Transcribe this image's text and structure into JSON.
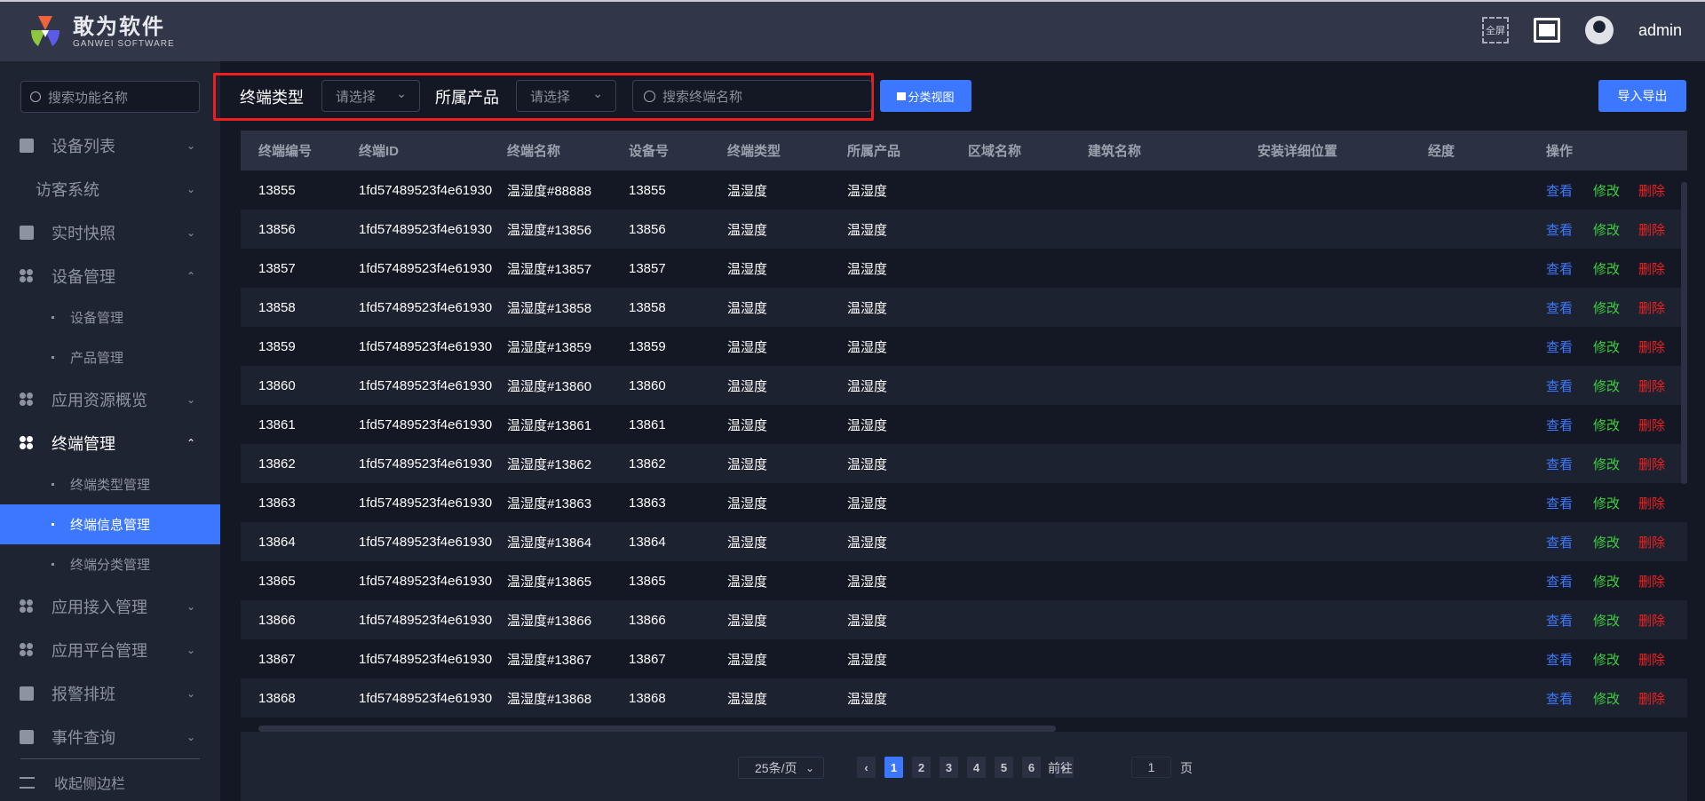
{
  "header": {
    "logo_cn": "敢为软件",
    "logo_en": "GANWEI SOFTWARE",
    "fullscreen_label": "全屏",
    "username": "admin"
  },
  "sidebar": {
    "search_placeholder": "搜索功能名称",
    "items": [
      {
        "label": "设备列表",
        "icon": "monitor-icon",
        "chevron": "⌄"
      },
      {
        "label": "访客系统",
        "icon": "",
        "chevron": "⌄"
      },
      {
        "label": "实时快照",
        "icon": "camera-icon",
        "chevron": "⌄"
      },
      {
        "label": "设备管理",
        "icon": "clover-icon",
        "chevron": "⌃",
        "children": [
          "设备管理",
          "产品管理"
        ]
      },
      {
        "label": "应用资源概览",
        "icon": "clover-icon",
        "chevron": "⌄"
      },
      {
        "label": "终端管理",
        "icon": "clover-icon",
        "chevron": "⌃",
        "children": [
          "终端类型管理",
          "终端信息管理",
          "终端分类管理"
        ]
      },
      {
        "label": "应用接入管理",
        "icon": "clover-icon",
        "chevron": "⌄"
      },
      {
        "label": "应用平台管理",
        "icon": "clover-icon",
        "chevron": "⌄"
      },
      {
        "label": "报警排班",
        "icon": "calendar-icon",
        "chevron": "⌄"
      },
      {
        "label": "事件查询",
        "icon": "document-search-icon",
        "chevron": "⌄"
      }
    ],
    "collapse_label": "收起侧边栏"
  },
  "filter": {
    "type_label": "终端类型",
    "type_placeholder": "请选择",
    "product_label": "所属产品",
    "product_placeholder": "请选择",
    "search_placeholder": "搜索终端名称",
    "category_view_button": "分类视图",
    "import_export_button": "导入导出"
  },
  "table": {
    "columns": [
      "终端编号",
      "终端ID",
      "终端名称",
      "设备号",
      "终端类型",
      "所属产品",
      "区域名称",
      "建筑名称",
      "安装详细位置",
      "经度",
      "操作"
    ],
    "actions": {
      "view": "查看",
      "edit": "修改",
      "delete": "删除"
    },
    "rows": [
      [
        "13855",
        "1fd57489523f4e61930",
        "温湿度#88888",
        "13855",
        "温湿度",
        "温湿度"
      ],
      [
        "13856",
        "1fd57489523f4e61930",
        "温湿度#13856",
        "13856",
        "温湿度",
        "温湿度"
      ],
      [
        "13857",
        "1fd57489523f4e61930",
        "温湿度#13857",
        "13857",
        "温湿度",
        "温湿度"
      ],
      [
        "13858",
        "1fd57489523f4e61930",
        "温湿度#13858",
        "13858",
        "温湿度",
        "温湿度"
      ],
      [
        "13859",
        "1fd57489523f4e61930",
        "温湿度#13859",
        "13859",
        "温湿度",
        "温湿度"
      ],
      [
        "13860",
        "1fd57489523f4e61930",
        "温湿度#13860",
        "13860",
        "温湿度",
        "温湿度"
      ],
      [
        "13861",
        "1fd57489523f4e61930",
        "温湿度#13861",
        "13861",
        "温湿度",
        "温湿度"
      ],
      [
        "13862",
        "1fd57489523f4e61930",
        "温湿度#13862",
        "13862",
        "温湿度",
        "温湿度"
      ],
      [
        "13863",
        "1fd57489523f4e61930",
        "温湿度#13863",
        "13863",
        "温湿度",
        "温湿度"
      ],
      [
        "13864",
        "1fd57489523f4e61930",
        "温湿度#13864",
        "13864",
        "温湿度",
        "温湿度"
      ],
      [
        "13865",
        "1fd57489523f4e61930",
        "温湿度#13865",
        "13865",
        "温湿度",
        "温湿度"
      ],
      [
        "13866",
        "1fd57489523f4e61930",
        "温湿度#13866",
        "13866",
        "温湿度",
        "温湿度"
      ],
      [
        "13867",
        "1fd57489523f4e61930",
        "温湿度#13867",
        "13867",
        "温湿度",
        "温湿度"
      ],
      [
        "13868",
        "1fd57489523f4e61930",
        "温湿度#13868",
        "13868",
        "温湿度",
        "温湿度"
      ]
    ]
  },
  "pagination": {
    "page_size": "25条/页",
    "pages": [
      "1",
      "2",
      "3",
      "4",
      "5",
      "6"
    ],
    "current": "1",
    "prev": "‹",
    "next": "›",
    "goto_label": "前往",
    "goto_value": "1",
    "goto_suffix": "页"
  },
  "colors": {
    "accent": "#3c78ff",
    "view": "#3c78ff",
    "edit": "#3ccf3c",
    "delete": "#f02020",
    "highlight_box": "#f01d1d"
  }
}
